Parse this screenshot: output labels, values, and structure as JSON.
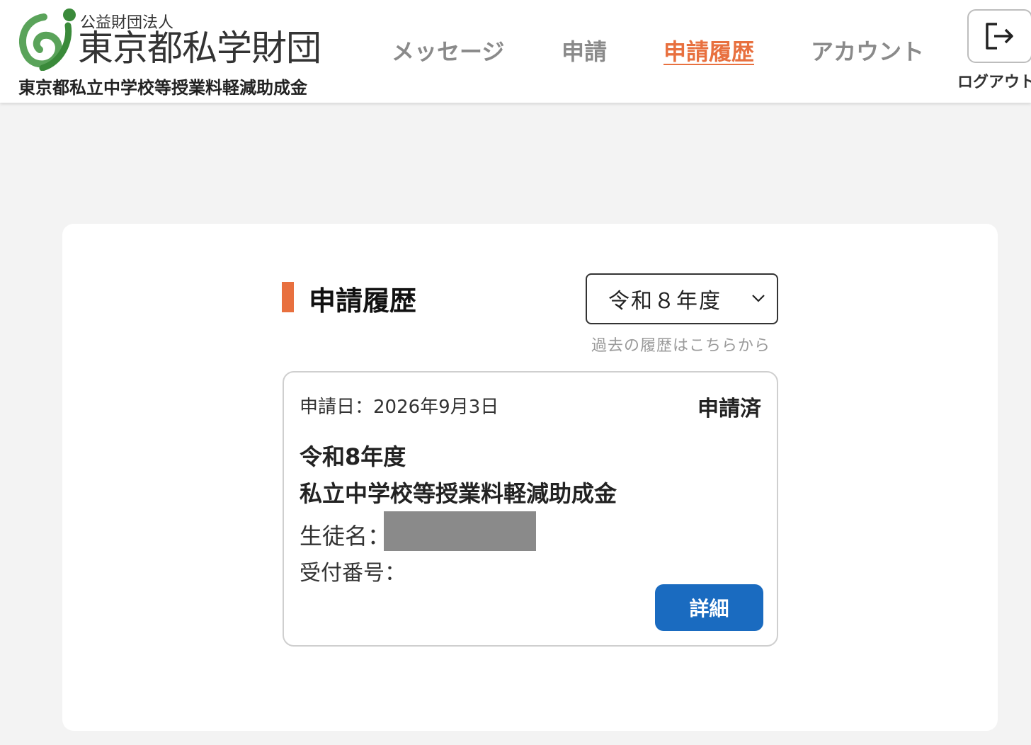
{
  "header": {
    "logo_icon": "tokyo-private-school-foundation-logo",
    "corp_type": "公益財団法人",
    "org_name": "東京都私学財団",
    "program_name": "東京都私立中学校等授業料軽減助成金",
    "nav": [
      {
        "label": "メッセージ",
        "active": false
      },
      {
        "label": "申請",
        "active": false
      },
      {
        "label": "申請履歴",
        "active": true
      },
      {
        "label": "アカウント",
        "active": false
      }
    ],
    "logout_label": "ログアウト",
    "logout_icon": "logout-arrow-icon"
  },
  "main": {
    "section_title": "申請履歴",
    "year_select": {
      "selected": "令和８年度",
      "icon": "chevron-down-icon"
    },
    "past_note": "過去の履歴はこちらから",
    "card": {
      "apply_date": "申請日：2026年9月3日",
      "status": "申請済",
      "year": "令和8年度",
      "program": "私立中学校等授業料軽減助成金",
      "student_label": "生徒名：",
      "receipt_label": "受付番号：",
      "detail_label": "詳細"
    }
  },
  "colors": {
    "accent": "#e8703f",
    "primary_button": "#1a6bc0",
    "logo_green": "#5aa35a",
    "redaction": "#8a8a8a"
  }
}
